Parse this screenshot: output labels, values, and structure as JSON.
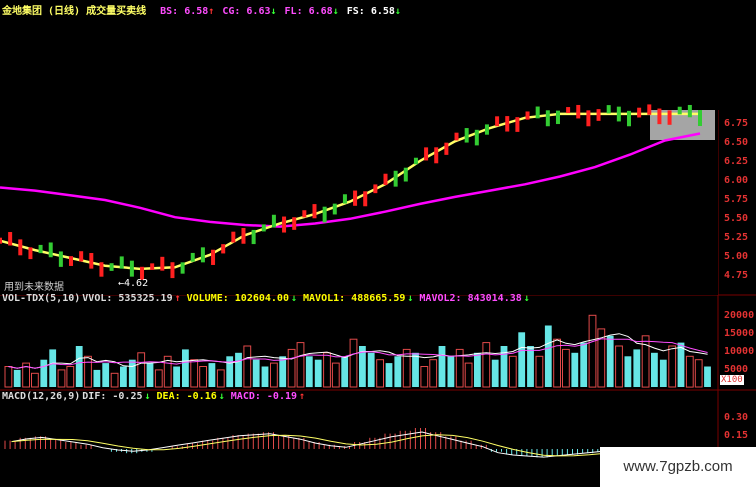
{
  "header": {
    "title": "金地集团 (日线) 成交量买卖线",
    "indicators": [
      {
        "label": "BS: 6.58",
        "arrow": "↑",
        "color": "#ff4dff"
      },
      {
        "label": "CG: 6.63",
        "arrow": "↓",
        "color": "#ff4dff"
      },
      {
        "label": "FL: 6.68",
        "arrow": "↓",
        "color": "#ff4dff"
      },
      {
        "label": "FS: 6.58",
        "arrow": "↓",
        "color": "#ffffff"
      }
    ]
  },
  "price_panel": {
    "y_ticks": [
      "6.75",
      "6.50",
      "6.25",
      "6.00",
      "5.75",
      "5.50",
      "5.25",
      "5.00",
      "4.75"
    ],
    "low_mark": "←4.62",
    "note": "用到未来数据"
  },
  "volume_panel": {
    "header": [
      {
        "text": "VOL-TDX(5,10)",
        "color": "#dddddd"
      },
      {
        "text": "VVOL: 535325.19",
        "color": "#dddddd"
      },
      {
        "text": "↑",
        "color": "#ff3333"
      },
      {
        "text": "VOLUME: 102604.00",
        "color": "#ffff00"
      },
      {
        "text": "↓",
        "color": "#33ff33"
      },
      {
        "text": "MAVOL1: 488665.59",
        "color": "#ffff00"
      },
      {
        "text": "↓",
        "color": "#33ff33"
      },
      {
        "text": "MAVOL2: 843014.38",
        "color": "#ff4dff"
      },
      {
        "text": "↓",
        "color": "#33ff33"
      }
    ],
    "y_ticks": [
      "20000",
      "15000",
      "10000",
      "5000"
    ],
    "unit": "X100"
  },
  "macd_panel": {
    "header": [
      {
        "text": "MACD(12,26,9)",
        "color": "#dddddd"
      },
      {
        "text": "DIF: -0.25",
        "color": "#dddddd"
      },
      {
        "text": "↓",
        "color": "#33ff33"
      },
      {
        "text": "DEA: -0.16",
        "color": "#ffff00"
      },
      {
        "text": "↓",
        "color": "#33ff33"
      },
      {
        "text": "MACD: -0.19",
        "color": "#ff4dff"
      },
      {
        "text": "↑",
        "color": "#ff3333"
      }
    ],
    "y_ticks": [
      "0.30",
      "0.15"
    ]
  },
  "watermark": "www.7gpzb.com",
  "chart_data": [
    {
      "type": "line",
      "name": "price",
      "x": [
        0,
        5,
        10,
        15,
        20,
        25,
        30,
        35,
        40,
        45,
        50,
        55,
        60,
        65,
        70,
        75,
        80,
        85,
        90,
        95,
        100
      ],
      "series": [
        {
          "color": "#ff00ff",
          "values": [
            5.86,
            5.82,
            5.76,
            5.7,
            5.6,
            5.48,
            5.42,
            5.38,
            5.36,
            5.4,
            5.46,
            5.55,
            5.65,
            5.74,
            5.82,
            5.9,
            6.0,
            6.12,
            6.28,
            6.46,
            6.55
          ]
        },
        {
          "color": "#ffff66",
          "values": [
            5.18,
            5.06,
            4.96,
            4.86,
            4.82,
            4.84,
            5.0,
            5.25,
            5.4,
            5.52,
            5.68,
            5.9,
            6.2,
            6.45,
            6.62,
            6.75,
            6.8,
            6.8,
            6.8,
            6.8,
            6.8
          ]
        }
      ],
      "ylim": [
        4.55,
        6.85
      ]
    },
    {
      "type": "bar",
      "name": "volume",
      "values": [
        6,
        5,
        7,
        4,
        8,
        11,
        5,
        6,
        12,
        9,
        5,
        7,
        4,
        6,
        8,
        10,
        7,
        5,
        9,
        6,
        11,
        8,
        6,
        7,
        5,
        9,
        10,
        12,
        8,
        6,
        7,
        9,
        11,
        13,
        9,
        8,
        10,
        7,
        9,
        14,
        12,
        10,
        8,
        7,
        9,
        11,
        10,
        6,
        8,
        12,
        9,
        11,
        7,
        10,
        13,
        8,
        12,
        9,
        16,
        12,
        9,
        18,
        14,
        11,
        10,
        13,
        21,
        17,
        15,
        12,
        9,
        11,
        15,
        10,
        8,
        12,
        13,
        9,
        8,
        6
      ],
      "ylim": [
        0,
        24000
      ]
    },
    {
      "type": "bar",
      "name": "macd",
      "values": [
        0.06,
        0.08,
        0.09,
        0.07,
        0.05,
        0.03,
        0.0,
        -0.02,
        -0.03,
        -0.02,
        0.0,
        0.02,
        0.04,
        0.06,
        0.08,
        0.1,
        0.11,
        0.12,
        0.1,
        0.08,
        0.05,
        0.03,
        0.02,
        0.05,
        0.08,
        0.11,
        0.13,
        0.15,
        0.12,
        0.09,
        0.06,
        0.03,
        -0.02,
        -0.04,
        -0.05,
        -0.06,
        -0.05,
        -0.04,
        -0.03,
        -0.02
      ],
      "ylim": [
        -0.15,
        0.35
      ]
    }
  ]
}
